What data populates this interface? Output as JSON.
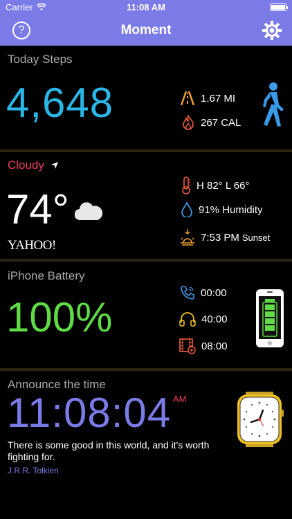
{
  "status": {
    "carrier": "Carrier",
    "time": "11:08 AM"
  },
  "nav": {
    "title": "Moment",
    "help_label": "?"
  },
  "steps": {
    "title": "Today Steps",
    "count": "4,648",
    "distance": "1.67 MI",
    "calories": "267 CAL"
  },
  "weather": {
    "condition": "Cloudy",
    "temperature": "74°",
    "provider": "YAHOO!",
    "high_low": "H 82° L 66°",
    "humidity": "91% Humidity",
    "sunset_time": "7:53 PM",
    "sunset_label": "Sunset"
  },
  "battery": {
    "title": "iPhone Battery",
    "level": "100%",
    "talk_time": "00:00",
    "audio_time": "40:00",
    "video_time": "08:00"
  },
  "announce": {
    "title": "Announce the time",
    "time": "11:08:04",
    "ampm": "AM",
    "quote": "There is some good in this world, and it's worth fighting for.",
    "author": "J.R.R. Tolkien"
  },
  "colors": {
    "accent": "#7b7be8",
    "steps_blue": "#2ab6e6",
    "weather_red": "#ec3b5a",
    "battery_green": "#5edb45",
    "icon_orange": "#f0a030",
    "icon_blue": "#3a9ae8"
  },
  "icons": [
    "wifi-icon",
    "help-icon",
    "gear-icon",
    "road-icon",
    "flame-icon",
    "walker-icon",
    "location-arrow-icon",
    "cloud-icon",
    "thermometer-icon",
    "drop-icon",
    "sunset-icon",
    "phone-icon",
    "headphones-icon",
    "film-icon",
    "iphone-battery-icon",
    "watch-icon"
  ]
}
